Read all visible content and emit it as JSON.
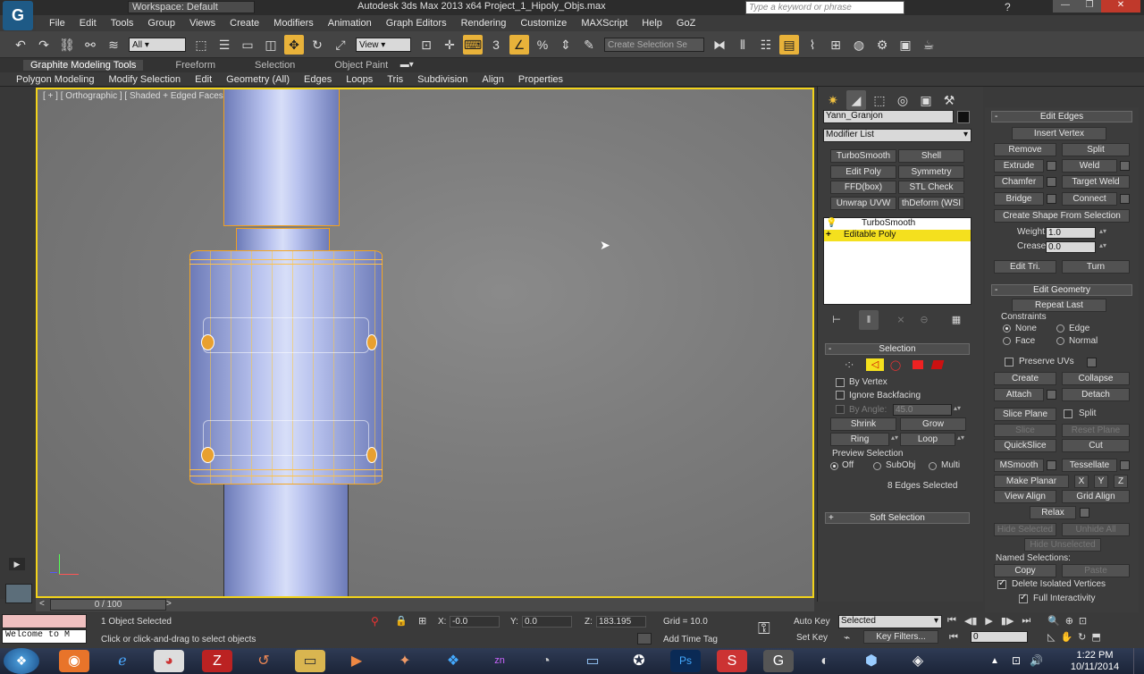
{
  "titlebar": {
    "workspace": "Workspace: Default",
    "title": "Autodesk 3ds Max  2013 x64      Project_1_Hipoly_Objs.max",
    "search_placeholder": "Type a keyword or phrase"
  },
  "menu": [
    "File",
    "Edit",
    "Tools",
    "Group",
    "Views",
    "Create",
    "Modifiers",
    "Animation",
    "Graph Editors",
    "Rendering",
    "Customize",
    "MAXScript",
    "Help",
    "GoZ"
  ],
  "toolbar": {
    "filter": "All",
    "refcoord": "View",
    "selset": "Create Selection Se"
  },
  "ribbon": {
    "tabs": [
      "Graphite Modeling Tools",
      "Freeform",
      "Selection",
      "Object Paint"
    ],
    "subtabs": [
      "Polygon Modeling",
      "Modify Selection",
      "Edit",
      "Geometry (All)",
      "Edges",
      "Loops",
      "Tris",
      "Subdivision",
      "Align",
      "Properties"
    ]
  },
  "viewport": {
    "label": "[ + ] [ Orthographic ] [ Shaded + Edged Faces ]"
  },
  "modify": {
    "object_name": "Yann_Granjon",
    "modifier_list": "Modifier List",
    "modifier_buttons": [
      "TurboSmooth",
      "Shell",
      "Edit Poly",
      "Symmetry",
      "FFD(box)",
      "STL Check",
      "Unwrap UVW",
      "thDeform (WSI"
    ],
    "stack": [
      "TurboSmooth",
      "Editable Poly"
    ],
    "selection": {
      "title": "Selection",
      "by_vertex": "By Vertex",
      "ignore_backfacing": "Ignore Backfacing",
      "by_angle": "By Angle:",
      "angle": "45.0",
      "shrink": "Shrink",
      "grow": "Grow",
      "ring": "Ring",
      "loop": "Loop",
      "preview": "Preview Selection",
      "off": "Off",
      "subobj": "SubObj",
      "multi": "Multi",
      "status": "8 Edges Selected"
    },
    "soft_selection": "Soft Selection"
  },
  "edit_edges": {
    "title": "Edit Edges",
    "insert_vertex": "Insert Vertex",
    "remove": "Remove",
    "split": "Split",
    "extrude": "Extrude",
    "weld": "Weld",
    "chamfer": "Chamfer",
    "target_weld": "Target Weld",
    "bridge": "Bridge",
    "connect": "Connect",
    "create_shape": "Create Shape From Selection",
    "weight_label": "Weight:",
    "weight": "1.0",
    "crease_label": "Crease:",
    "crease": "0.0",
    "edit_tri": "Edit Tri.",
    "turn": "Turn"
  },
  "edit_geometry": {
    "title": "Edit Geometry",
    "repeat_last": "Repeat Last",
    "constraints": "Constraints",
    "none": "None",
    "edge": "Edge",
    "face": "Face",
    "normal": "Normal",
    "preserve_uvs": "Preserve UVs",
    "create": "Create",
    "collapse": "Collapse",
    "attach": "Attach",
    "detach": "Detach",
    "slice_plane": "Slice Plane",
    "split": "Split",
    "slice": "Slice",
    "reset_plane": "Reset Plane",
    "quickslice": "QuickSlice",
    "cut": "Cut",
    "msmooth": "MSmooth",
    "tessellate": "Tessellate",
    "make_planar": "Make Planar",
    "x": "X",
    "y": "Y",
    "z": "Z",
    "view_align": "View Align",
    "grid_align": "Grid Align",
    "relax": "Relax",
    "hide_selected": "Hide Selected",
    "unhide_all": "Unhide All",
    "hide_unselected": "Hide Unselected",
    "named_sel": "Named Selections:",
    "copy": "Copy",
    "paste": "Paste",
    "delete_isolated": "Delete Isolated Vertices",
    "full_interactivity": "Full Interactivity"
  },
  "timeline": {
    "frame": "0 / 100"
  },
  "status": {
    "selected": "1 Object Selected",
    "prompt": "Click or click-and-drag to select objects",
    "listener": "Welcome to M",
    "x_label": "X:",
    "x": "-0.0",
    "y_label": "Y:",
    "y": "0.0",
    "z_label": "Z:",
    "z": "183.195",
    "grid": "Grid = 10.0",
    "add_time_tag": "Add Time Tag",
    "auto_key": "Auto Key",
    "set_key": "Set Key",
    "key_mode": "Selected",
    "key_filters": "Key Filters...",
    "frame": "0"
  },
  "clock": {
    "time": "1:22 PM",
    "date": "10/11/2014"
  }
}
